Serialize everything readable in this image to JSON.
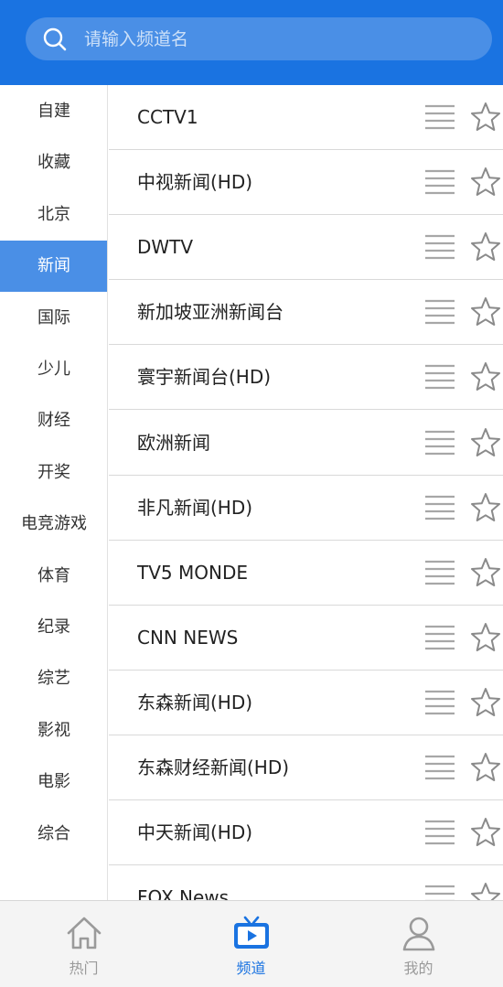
{
  "search": {
    "placeholder": "请输入频道名"
  },
  "categories": [
    "自建",
    "收藏",
    "北京",
    "新闻",
    "国际",
    "少儿",
    "财经",
    "开奖",
    "电竞游戏",
    "体育",
    "纪录",
    "综艺",
    "影视",
    "电影",
    "综合"
  ],
  "active_category": "新闻",
  "channels": [
    "CCTV1",
    "中视新闻(HD)",
    "DWTV",
    "新加坡亚洲新闻台",
    "寰宇新闻台(HD)",
    "欧洲新闻",
    "非凡新闻(HD)",
    "TV5 MONDE",
    "CNN NEWS",
    "东森新闻(HD)",
    "东森财经新闻(HD)",
    "中天新闻(HD)",
    "FOX News"
  ],
  "tabs": [
    {
      "label": "热门",
      "icon": "home-icon"
    },
    {
      "label": "频道",
      "icon": "tv-icon"
    },
    {
      "label": "我的",
      "icon": "user-icon"
    }
  ],
  "active_tab": "频道",
  "colors": {
    "brand": "#1a73e1",
    "search_bg": "#4a8fe6",
    "active_category_bg": "#4a8fe6",
    "inactive_icon": "#9a9a9a"
  }
}
